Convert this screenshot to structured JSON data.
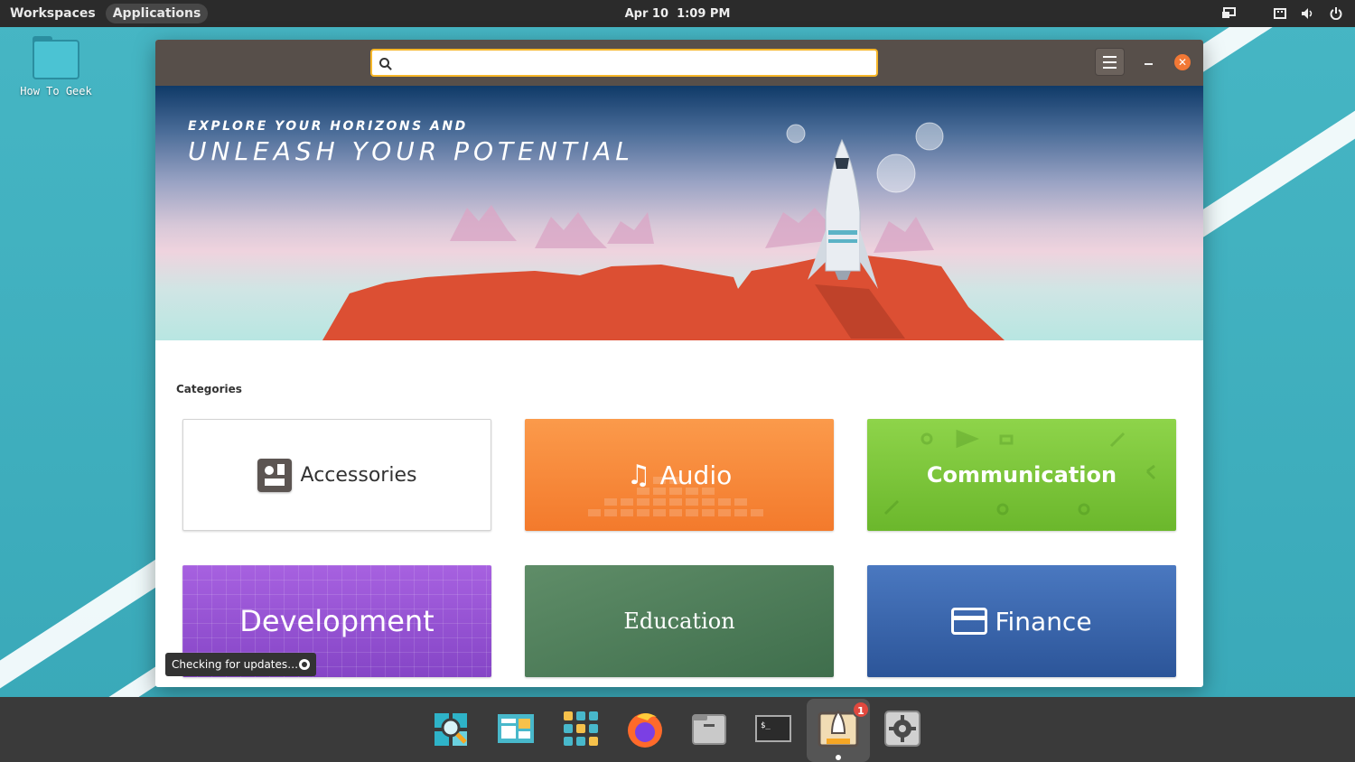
{
  "top_panel": {
    "workspaces": "Workspaces",
    "applications": "Applications",
    "date": "Apr 10",
    "time": "1:09 PM"
  },
  "desktop": {
    "folder_label": "How To Geek"
  },
  "window": {
    "search": {
      "value": "",
      "placeholder": ""
    },
    "banner": {
      "line1": "EXPLORE YOUR HORIZONS AND",
      "line2": "UNLEASH YOUR POTENTIAL"
    },
    "categories_title": "Categories",
    "categories": [
      {
        "label": "Accessories"
      },
      {
        "label": "Audio"
      },
      {
        "label": "Communication"
      },
      {
        "label": "Development"
      },
      {
        "label": "Education"
      },
      {
        "label": "Finance"
      }
    ],
    "toast": "Checking for updates…"
  },
  "dock": {
    "items": [
      "search-app",
      "window-manager",
      "app-grid",
      "firefox",
      "files",
      "terminal",
      "app-store",
      "settings"
    ],
    "store_badge": "1"
  },
  "colors": {
    "accent": "#f6b629",
    "close": "#f27835",
    "audio": "#f37a2c",
    "communication": "#6bb72c",
    "development": "#9b55d8",
    "education": "#4f7d5a",
    "finance": "#3a66ad"
  }
}
